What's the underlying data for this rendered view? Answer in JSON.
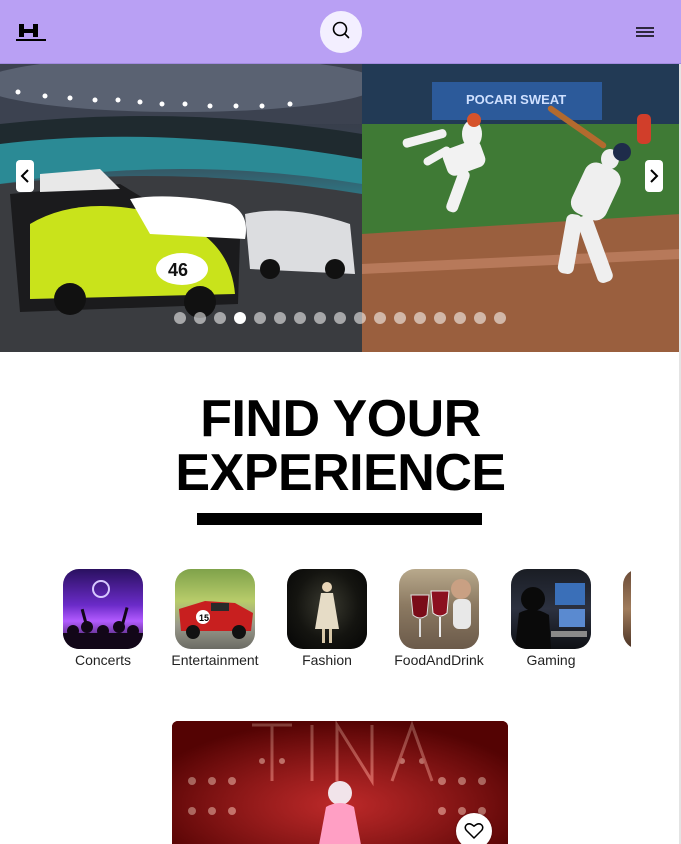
{
  "header": {
    "logo_icon": "h-logo-icon",
    "search_icon": "search-icon",
    "menu_icon": "hamburger-menu-icon",
    "background": "#b9a0f4"
  },
  "hero": {
    "slides": [
      "racing cars on track at night",
      "baseball pitcher and batter at stadium"
    ],
    "prev_icon": "chevron-left-icon",
    "next_icon": "chevron-right-icon",
    "dots_count": 17,
    "active_dot": 4
  },
  "main": {
    "heading_line1": "FIND YOUR",
    "heading_line2": "EXPERIENCE"
  },
  "categories": [
    {
      "label": "Concerts"
    },
    {
      "label": "Entertainment"
    },
    {
      "label": "Fashion"
    },
    {
      "label": "FoodAndDrink"
    },
    {
      "label": "Gaming"
    }
  ],
  "featured": {
    "favorite_icon": "heart-outline-icon"
  }
}
